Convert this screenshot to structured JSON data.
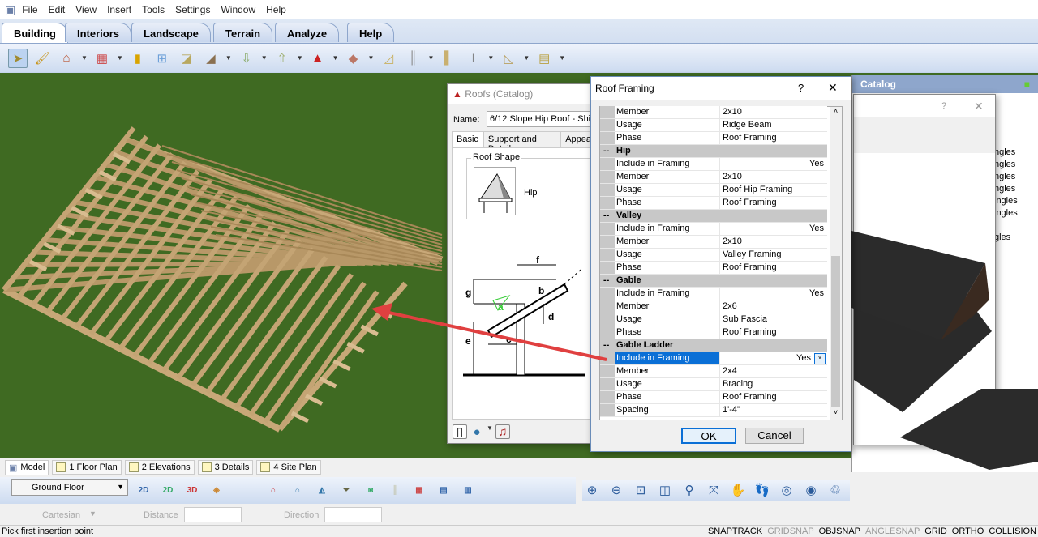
{
  "menu": [
    "File",
    "Edit",
    "View",
    "Insert",
    "Tools",
    "Settings",
    "Window",
    "Help"
  ],
  "ribbon_tabs": [
    {
      "label": "Building",
      "active": true
    },
    {
      "label": "Interiors"
    },
    {
      "label": "Landscape"
    },
    {
      "label": "Terrain"
    },
    {
      "label": "Analyze"
    },
    {
      "label": "Help"
    }
  ],
  "toolbar_icons": [
    "select-arrow-icon",
    "paintbrush-icon",
    "house-wizard-icon",
    "wall-icon",
    "door-icon",
    "window-icon",
    "opening-icon",
    "roof-slab-icon",
    "stair-down-icon",
    "stair-up-icon",
    "roof-icon",
    "gable-icon",
    "step-icon",
    "railing-icon",
    "column-icon",
    "beam-icon",
    "ramp-icon",
    "fascia-icon"
  ],
  "roofs_dialog": {
    "title": "Roofs (Catalog)",
    "name_label": "Name:",
    "name_value": "6/12 Slope Hip Roof - Shing",
    "tabs": [
      "Basic",
      "Support and Details",
      "Appea"
    ],
    "roof_shape_label": "Roof Shape",
    "roof_shape_value": "Hip",
    "diagram_labels": [
      "f",
      "g",
      "b",
      "a",
      "d",
      "e",
      "c"
    ]
  },
  "framing_dialog": {
    "title": "Roof Framing",
    "help": "?",
    "close": "✕",
    "ok": "OK",
    "cancel": "Cancel",
    "rows": [
      {
        "type": "prop",
        "label": "Member",
        "value": "2x10"
      },
      {
        "type": "prop",
        "label": "Usage",
        "value": "Ridge Beam"
      },
      {
        "type": "prop",
        "label": "Phase",
        "value": "Roof Framing"
      },
      {
        "type": "hdr",
        "label": "Hip"
      },
      {
        "type": "prop",
        "label": "Include in Framing",
        "value": "Yes",
        "right": true
      },
      {
        "type": "prop",
        "label": "Member",
        "value": "2x10"
      },
      {
        "type": "prop",
        "label": "Usage",
        "value": "Roof Hip Framing"
      },
      {
        "type": "prop",
        "label": "Phase",
        "value": "Roof Framing"
      },
      {
        "type": "hdr",
        "label": "Valley"
      },
      {
        "type": "prop",
        "label": "Include in Framing",
        "value": "Yes",
        "right": true
      },
      {
        "type": "prop",
        "label": "Member",
        "value": "2x10"
      },
      {
        "type": "prop",
        "label": "Usage",
        "value": "Valley Framing"
      },
      {
        "type": "prop",
        "label": "Phase",
        "value": "Roof Framing"
      },
      {
        "type": "hdr",
        "label": "Gable"
      },
      {
        "type": "prop",
        "label": "Include in Framing",
        "value": "Yes",
        "right": true
      },
      {
        "type": "prop",
        "label": "Member",
        "value": "2x6"
      },
      {
        "type": "prop",
        "label": "Usage",
        "value": "Sub Fascia"
      },
      {
        "type": "prop",
        "label": "Phase",
        "value": "Roof Framing"
      },
      {
        "type": "hdr",
        "label": "Gable Ladder"
      },
      {
        "type": "prop",
        "label": "Include in Framing",
        "value": "Yes",
        "right": true,
        "selected": true
      },
      {
        "type": "prop",
        "label": "Member",
        "value": "2x4"
      },
      {
        "type": "prop",
        "label": "Usage",
        "value": "Bracing"
      },
      {
        "type": "prop",
        "label": "Phase",
        "value": "Roof Framing"
      },
      {
        "type": "prop",
        "label": "Spacing",
        "value": "1'-4\""
      }
    ]
  },
  "catalog": {
    "title": "Catalog",
    "items": [
      "ngles",
      "ngles",
      "ngles",
      "ngles",
      "ingles",
      "ingles",
      "gles"
    ],
    "help": "?",
    "close": "✕"
  },
  "view_tabs": [
    "Model",
    "1 Floor Plan",
    "2 Elevations",
    "3 Details",
    "4 Site Plan"
  ],
  "floor_select": "Ground Floor",
  "coord": {
    "mode": "Cartesian",
    "distance_label": "Distance",
    "direction_label": "Direction"
  },
  "status": {
    "message": "Pick first insertion point",
    "snaps": [
      {
        "label": "SNAPTRACK",
        "on": true
      },
      {
        "label": "GRIDSNAP",
        "on": false
      },
      {
        "label": "OBJSNAP",
        "on": true
      },
      {
        "label": "ANGLESNAP",
        "on": false
      },
      {
        "label": "GRID",
        "on": true
      },
      {
        "label": "ORTHO",
        "on": true
      },
      {
        "label": "COLLISION",
        "on": true
      }
    ]
  },
  "colors": {
    "arrow": "#e04040",
    "selection": "#0a6fd6",
    "grass": "#3f6a22",
    "wood": "#c8a878"
  }
}
